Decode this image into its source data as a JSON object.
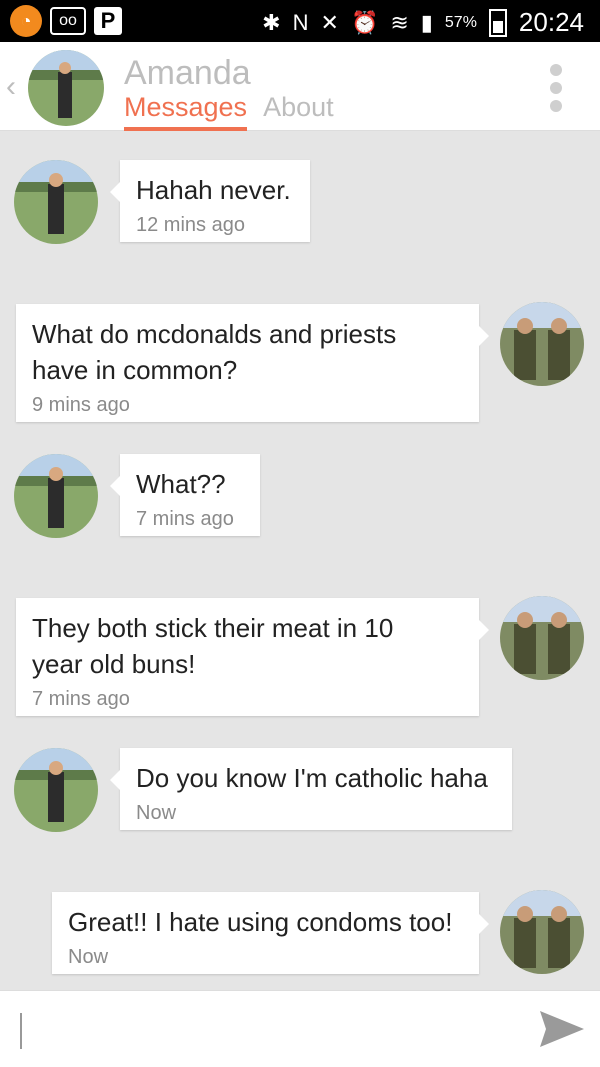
{
  "status_bar": {
    "battery": "57%",
    "time": "20:24",
    "icons_left": [
      "orange-app-icon",
      "voicemail-icon",
      "parking-icon"
    ],
    "icons_right": [
      "bluetooth-icon",
      "nfc-icon",
      "mute-icon",
      "alarm-icon",
      "wifi-icon",
      "signal-icon"
    ]
  },
  "header": {
    "name": "Amanda",
    "tabs": [
      {
        "label": "Messages"
      },
      {
        "label": "About"
      }
    ],
    "accent": "#f07150"
  },
  "messages": [
    {
      "side": "left",
      "text": [
        "Hahah never."
      ],
      "time": "12 mins ago"
    },
    {
      "side": "right",
      "text": [
        "What do mcdonalds and priests",
        "have in common?"
      ],
      "time": "9 mins ago"
    },
    {
      "side": "left",
      "text": [
        "What??"
      ],
      "time": "7 mins ago"
    },
    {
      "side": "right",
      "text": [
        "They both stick their meat in 10",
        "year old buns!"
      ],
      "time": "7 mins ago"
    },
    {
      "side": "left",
      "text": [
        "Do you know I'm catholic haha"
      ],
      "time": "Now"
    },
    {
      "side": "right",
      "text": [
        "Great!! I hate using condoms too!"
      ],
      "time": "Now"
    }
  ],
  "input": {
    "placeholder": ""
  }
}
